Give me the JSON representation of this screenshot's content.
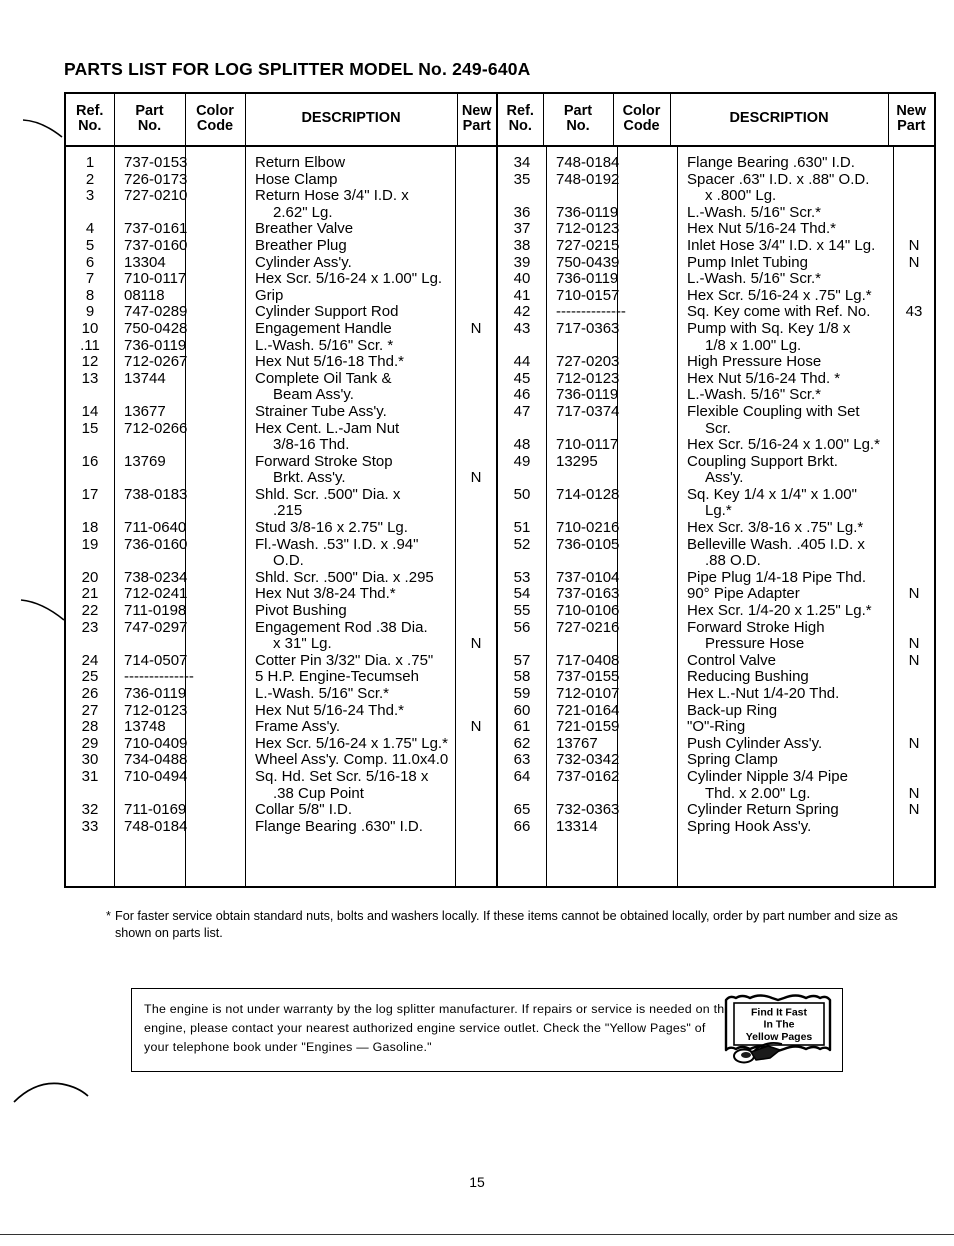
{
  "document": {
    "title": "PARTS LIST FOR LOG SPLITTER MODEL No. 249-640A",
    "page_number": "15"
  },
  "table": {
    "headers": {
      "ref_no": "Ref.\nNo.",
      "ref_no_line1": "Ref.",
      "ref_no_line2": "No.",
      "part_no_line1": "Part",
      "part_no_line2": "No.",
      "color_code_line1": "Color",
      "color_code_line2": "Code",
      "description": "DESCRIPTION",
      "new_part_line1": "New",
      "new_part_line2": "Part"
    },
    "left_rows": [
      {
        "ref": "1",
        "part": "737-0153",
        "color": "",
        "desc": "Return Elbow",
        "new": ""
      },
      {
        "ref": "2",
        "part": "726-0173",
        "color": "",
        "desc": "Hose Clamp",
        "new": ""
      },
      {
        "ref": "3",
        "part": "727-0210",
        "color": "",
        "desc": "Return Hose 3/4\" I.D. x",
        "new": ""
      },
      {
        "ref": "",
        "part": "",
        "color": "",
        "desc": "2.62\" Lg.",
        "new": "",
        "indent": true
      },
      {
        "ref": "4",
        "part": "737-0161",
        "color": "",
        "desc": "Breather Valve",
        "new": ""
      },
      {
        "ref": "5",
        "part": "737-0160",
        "color": "",
        "desc": "Breather Plug",
        "new": ""
      },
      {
        "ref": "6",
        "part": "13304",
        "color": "",
        "desc": "Cylinder Ass'y.",
        "new": ""
      },
      {
        "ref": "7",
        "part": "710-0117",
        "color": "",
        "desc": "Hex Scr. 5/16-24 x 1.00\" Lg.",
        "new": ""
      },
      {
        "ref": "8",
        "part": "08118",
        "color": "",
        "desc": "Grip",
        "new": ""
      },
      {
        "ref": "9",
        "part": "747-0289",
        "color": "",
        "desc": "Cylinder Support Rod",
        "new": ""
      },
      {
        "ref": "10",
        "part": "750-0428",
        "color": "",
        "desc": "Engagement Handle",
        "new": "N"
      },
      {
        "ref": ".11",
        "part": "736-0119",
        "color": "",
        "desc": "L.-Wash. 5/16\" Scr. *",
        "new": ""
      },
      {
        "ref": "12",
        "part": "712-0267",
        "color": "",
        "desc": "Hex Nut 5/16-18 Thd.*",
        "new": ""
      },
      {
        "ref": "13",
        "part": "13744",
        "color": "",
        "desc": "Complete Oil Tank &",
        "new": ""
      },
      {
        "ref": "",
        "part": "",
        "color": "",
        "desc": "Beam Ass'y.",
        "new": "",
        "indent": true
      },
      {
        "ref": "14",
        "part": "13677",
        "color": "",
        "desc": "Strainer Tube Ass'y.",
        "new": ""
      },
      {
        "ref": "15",
        "part": "712-0266",
        "color": "",
        "desc": "Hex Cent. L.-Jam Nut",
        "new": ""
      },
      {
        "ref": "",
        "part": "",
        "color": "",
        "desc": "3/8-16 Thd.",
        "new": "",
        "indent": true
      },
      {
        "ref": "16",
        "part": "13769",
        "color": "",
        "desc": "Forward Stroke Stop",
        "new": ""
      },
      {
        "ref": "",
        "part": "",
        "color": "",
        "desc": "Brkt. Ass'y.",
        "new": "N",
        "indent": true
      },
      {
        "ref": "17",
        "part": "738-0183",
        "color": "",
        "desc": "Shld. Scr. .500\" Dia. x",
        "new": ""
      },
      {
        "ref": "",
        "part": "",
        "color": "",
        "desc": ".215",
        "new": "",
        "indent": true
      },
      {
        "ref": "18",
        "part": "711-0640",
        "color": "",
        "desc": "Stud 3/8-16 x 2.75\" Lg.",
        "new": ""
      },
      {
        "ref": "19",
        "part": "736-0160",
        "color": "",
        "desc": "Fl.-Wash. .53\" I.D. x .94\"",
        "new": ""
      },
      {
        "ref": "",
        "part": "",
        "color": "",
        "desc": "O.D.",
        "new": "",
        "indent": true
      },
      {
        "ref": "20",
        "part": "738-0234",
        "color": "",
        "desc": "Shld. Scr. .500\" Dia. x .295",
        "new": ""
      },
      {
        "ref": "21",
        "part": "712-0241",
        "color": "",
        "desc": "Hex Nut 3/8-24 Thd.*",
        "new": ""
      },
      {
        "ref": "22",
        "part": "711-0198",
        "color": "",
        "desc": "Pivot Bushing",
        "new": ""
      },
      {
        "ref": "23",
        "part": "747-0297",
        "color": "",
        "desc": "Engagement Rod .38 Dia.",
        "new": ""
      },
      {
        "ref": "",
        "part": "",
        "color": "",
        "desc": "x 31\" Lg.",
        "new": "N",
        "indent": true
      },
      {
        "ref": "24",
        "part": "714-0507",
        "color": "",
        "desc": "Cotter Pin 3/32\" Dia. x .75\"",
        "new": ""
      },
      {
        "ref": "25",
        "part": "--------------",
        "color": "",
        "desc": "5 H.P. Engine-Tecumseh",
        "new": ""
      },
      {
        "ref": "26",
        "part": "736-0119",
        "color": "",
        "desc": "L.-Wash. 5/16\" Scr.*",
        "new": ""
      },
      {
        "ref": "27",
        "part": "712-0123",
        "color": "",
        "desc": "Hex Nut 5/16-24 Thd.*",
        "new": ""
      },
      {
        "ref": "28",
        "part": "13748",
        "color": "",
        "desc": "Frame Ass'y.",
        "new": "N"
      },
      {
        "ref": "29",
        "part": "710-0409",
        "color": "",
        "desc": "Hex Scr. 5/16-24 x 1.75\" Lg.*",
        "new": ""
      },
      {
        "ref": "30",
        "part": "734-0488",
        "color": "",
        "desc": "Wheel Ass'y. Comp. 11.0x4.0",
        "new": ""
      },
      {
        "ref": "31",
        "part": "710-0494",
        "color": "",
        "desc": "Sq. Hd. Set Scr. 5/16-18 x",
        "new": ""
      },
      {
        "ref": "",
        "part": "",
        "color": "",
        "desc": ".38 Cup Point",
        "new": "",
        "indent": true
      },
      {
        "ref": "32",
        "part": "711-0169",
        "color": "",
        "desc": "Collar 5/8\" I.D.",
        "new": ""
      },
      {
        "ref": "33",
        "part": "748-0184",
        "color": "",
        "desc": "Flange Bearing .630\" I.D.",
        "new": ""
      }
    ],
    "right_rows": [
      {
        "ref": "34",
        "part": "748-0184",
        "color": "",
        "desc": "Flange Bearing .630\" I.D.",
        "new": ""
      },
      {
        "ref": "35",
        "part": "748-0192",
        "color": "",
        "desc": "Spacer .63\" I.D. x .88\" O.D.",
        "new": ""
      },
      {
        "ref": "",
        "part": "",
        "color": "",
        "desc": "x .800\" Lg.",
        "new": "",
        "indent": true
      },
      {
        "ref": "36",
        "part": "736-0119",
        "color": "",
        "desc": "L.-Wash. 5/16\" Scr.*",
        "new": ""
      },
      {
        "ref": "37",
        "part": "712-0123",
        "color": "",
        "desc": "Hex Nut 5/16-24 Thd.*",
        "new": ""
      },
      {
        "ref": "38",
        "part": "727-0215",
        "color": "",
        "desc": "Inlet Hose 3/4\" I.D. x 14\" Lg.",
        "new": "N"
      },
      {
        "ref": "39",
        "part": "750-0439",
        "color": "",
        "desc": "Pump Inlet Tubing",
        "new": "N"
      },
      {
        "ref": "40",
        "part": "736-0119",
        "color": "",
        "desc": "L.-Wash. 5/16\" Scr.*",
        "new": ""
      },
      {
        "ref": "41",
        "part": "710-0157",
        "color": "",
        "desc": "Hex Scr. 5/16-24 x .75\"  Lg.*",
        "new": ""
      },
      {
        "ref": "42",
        "part": "--------------",
        "color": "",
        "desc": "Sq. Key come with Ref. No.",
        "new": "43"
      },
      {
        "ref": "43",
        "part": "717-0363",
        "color": "",
        "desc": "Pump with Sq. Key 1/8 x",
        "new": ""
      },
      {
        "ref": "",
        "part": "",
        "color": "",
        "desc": "1/8 x 1.00\" Lg.",
        "new": "",
        "indent": true
      },
      {
        "ref": "44",
        "part": "727-0203",
        "color": "",
        "desc": "High Pressure Hose",
        "new": ""
      },
      {
        "ref": "45",
        "part": "712-0123",
        "color": "",
        "desc": "Hex Nut 5/16-24 Thd. *",
        "new": ""
      },
      {
        "ref": "46",
        "part": "736-0119",
        "color": "",
        "desc": "L.-Wash. 5/16\" Scr.*",
        "new": ""
      },
      {
        "ref": "47",
        "part": "717-0374",
        "color": "",
        "desc": "Flexible Coupling with Set",
        "new": ""
      },
      {
        "ref": "",
        "part": "",
        "color": "",
        "desc": "Scr.",
        "new": "",
        "indent": true
      },
      {
        "ref": "48",
        "part": "710-0117",
        "color": "",
        "desc": "Hex Scr. 5/16-24 x 1.00\"  Lg.*",
        "new": ""
      },
      {
        "ref": "49",
        "part": "13295",
        "color": "",
        "desc": "Coupling Support Brkt.",
        "new": ""
      },
      {
        "ref": "",
        "part": "",
        "color": "",
        "desc": "Ass'y.",
        "new": "",
        "indent": true
      },
      {
        "ref": "50",
        "part": "714-0128",
        "color": "",
        "desc": "Sq. Key 1/4 x 1/4\" x 1.00\"",
        "new": ""
      },
      {
        "ref": "",
        "part": "",
        "color": "",
        "desc": "Lg.*",
        "new": "",
        "indent": true
      },
      {
        "ref": "51",
        "part": "710-0216",
        "color": "",
        "desc": "Hex Scr. 3/8-16 x .75\" Lg.*",
        "new": ""
      },
      {
        "ref": "52",
        "part": "736-0105",
        "color": "",
        "desc": "Belleville Wash. .405 I.D. x",
        "new": ""
      },
      {
        "ref": "",
        "part": "",
        "color": "",
        "desc": ".88 O.D.",
        "new": "",
        "indent": true
      },
      {
        "ref": "53",
        "part": "737-0104",
        "color": "",
        "desc": "Pipe Plug 1/4-18 Pipe Thd.",
        "new": ""
      },
      {
        "ref": "54",
        "part": "737-0163",
        "color": "",
        "desc": "90° Pipe Adapter",
        "new": "N"
      },
      {
        "ref": "55",
        "part": "710-0106",
        "color": "",
        "desc": "Hex Scr. 1/4-20 x 1.25\" Lg.*",
        "new": ""
      },
      {
        "ref": "56",
        "part": "727-0216",
        "color": "",
        "desc": "Forward Stroke High",
        "new": ""
      },
      {
        "ref": "",
        "part": "",
        "color": "",
        "desc": "Pressure Hose",
        "new": "N",
        "indent": true
      },
      {
        "ref": "57",
        "part": "717-0408",
        "color": "",
        "desc": "Control Valve",
        "new": "N"
      },
      {
        "ref": "58",
        "part": "737-0155",
        "color": "",
        "desc": "Reducing Bushing",
        "new": ""
      },
      {
        "ref": "59",
        "part": "712-0107",
        "color": "",
        "desc": "Hex L.-Nut 1/4-20 Thd.",
        "new": ""
      },
      {
        "ref": "60",
        "part": "721-0164",
        "color": "",
        "desc": "Back-up Ring",
        "new": ""
      },
      {
        "ref": "61",
        "part": "721-0159",
        "color": "",
        "desc": "\"O\"-Ring",
        "new": ""
      },
      {
        "ref": "62",
        "part": "13767",
        "color": "",
        "desc": "Push Cylinder Ass'y.",
        "new": "N"
      },
      {
        "ref": "63",
        "part": "732-0342",
        "color": "",
        "desc": "Spring Clamp",
        "new": ""
      },
      {
        "ref": "64",
        "part": "737-0162",
        "color": "",
        "desc": "Cylinder Nipple 3/4 Pipe",
        "new": ""
      },
      {
        "ref": "",
        "part": "",
        "color": "",
        "desc": "Thd. x 2.00\" Lg.",
        "new": "N",
        "indent": true
      },
      {
        "ref": "65",
        "part": "732-0363",
        "color": "",
        "desc": "Cylinder Return Spring",
        "new": "N"
      },
      {
        "ref": "66",
        "part": "13314",
        "color": "",
        "desc": "Spring Hook Ass'y.",
        "new": ""
      }
    ]
  },
  "footnote": {
    "marker": "*",
    "text": "For faster service obtain standard nuts, bolts and washers locally. If these items cannot be obtained locally, order by part number and size as shown on parts list."
  },
  "notice": {
    "text": "The engine is not under warranty by the log splitter manufacturer. If repairs or service is needed on the engine, please contact your nearest authorized engine service outlet. Check the \"Yellow Pages\" of your telephone book under \"Engines — Gasoline.\"",
    "logo": {
      "line1": "Find It Fast",
      "line2": "In The",
      "line3": "Yellow Pages"
    }
  }
}
